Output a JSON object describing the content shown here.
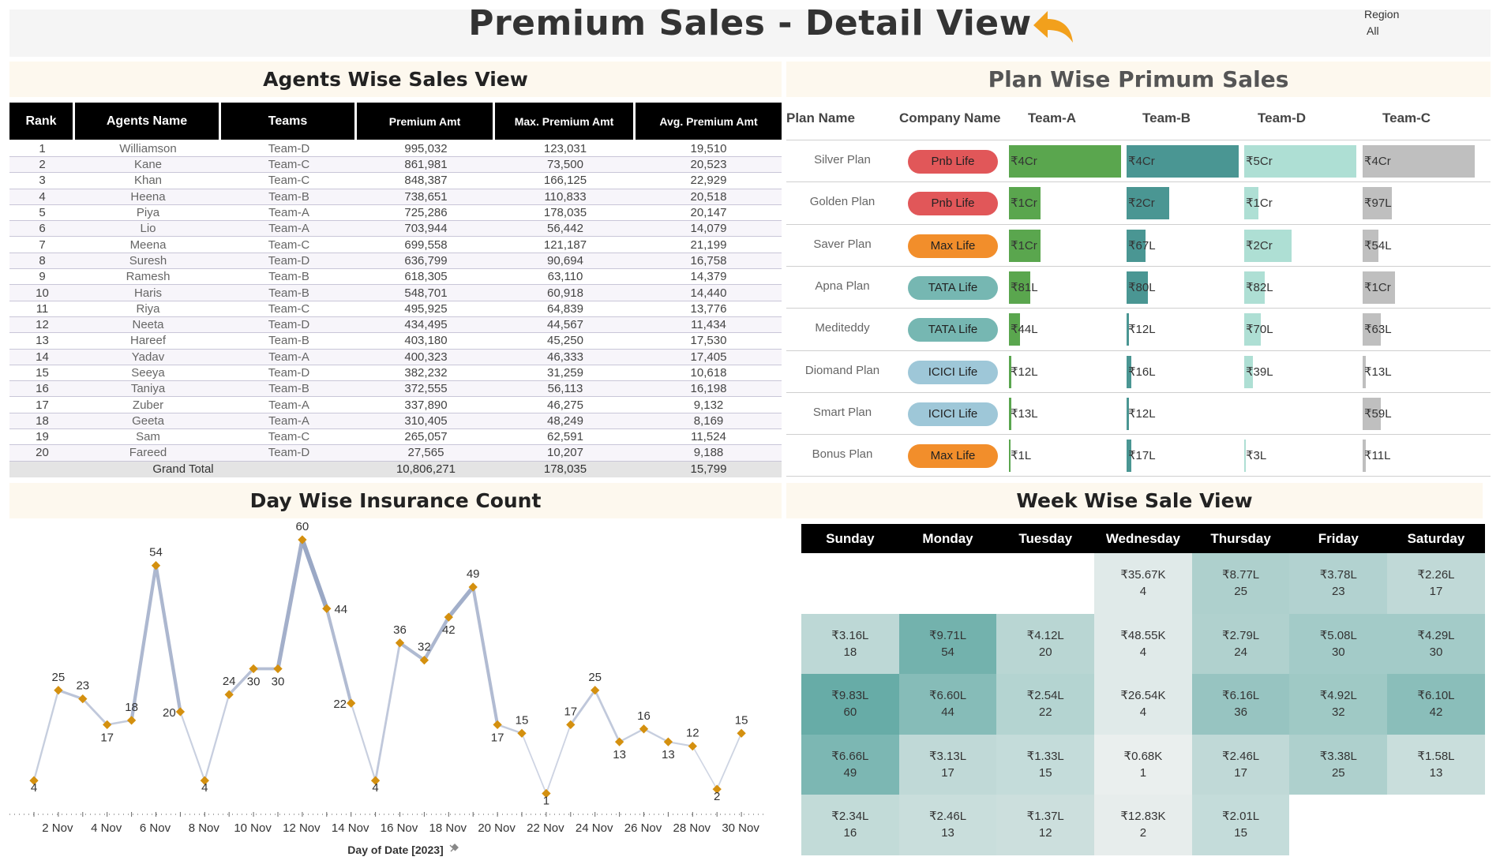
{
  "header": {
    "title": "Premium Sales - Detail View",
    "filter_label": "Region",
    "filter_value": "All",
    "back_icon": "back-arrow-icon"
  },
  "agents": {
    "title": "Agents Wise Sales View",
    "columns": [
      "Rank",
      "Agents Name",
      "Teams",
      "Premium Amt",
      "Max. Premium Amt",
      "Avg. Premium Amt"
    ],
    "rows": [
      [
        "1",
        "Williamson",
        "Team-D",
        "995,032",
        "123,031",
        "19,510"
      ],
      [
        "2",
        "Kane",
        "Team-C",
        "861,981",
        "73,500",
        "20,523"
      ],
      [
        "3",
        "Khan",
        "Team-C",
        "848,387",
        "166,125",
        "22,929"
      ],
      [
        "4",
        "Heena",
        "Team-B",
        "738,651",
        "110,833",
        "20,518"
      ],
      [
        "5",
        "Piya",
        "Team-A",
        "725,286",
        "178,035",
        "20,147"
      ],
      [
        "6",
        "Lio",
        "Team-A",
        "703,944",
        "56,442",
        "14,079"
      ],
      [
        "7",
        "Meena",
        "Team-C",
        "699,558",
        "121,187",
        "21,199"
      ],
      [
        "8",
        "Suresh",
        "Team-D",
        "636,799",
        "90,694",
        "16,758"
      ],
      [
        "9",
        "Ramesh",
        "Team-B",
        "618,305",
        "63,110",
        "14,379"
      ],
      [
        "10",
        "Haris",
        "Team-B",
        "548,701",
        "60,918",
        "14,440"
      ],
      [
        "11",
        "Riya",
        "Team-C",
        "495,925",
        "64,839",
        "13,776"
      ],
      [
        "12",
        "Neeta",
        "Team-D",
        "434,495",
        "44,567",
        "11,434"
      ],
      [
        "13",
        "Hareef",
        "Team-B",
        "403,180",
        "45,250",
        "17,530"
      ],
      [
        "14",
        "Yadav",
        "Team-A",
        "400,323",
        "46,333",
        "17,405"
      ],
      [
        "15",
        "Seeya",
        "Team-D",
        "382,232",
        "31,259",
        "10,618"
      ],
      [
        "16",
        "Taniya",
        "Team-B",
        "372,555",
        "56,113",
        "16,198"
      ],
      [
        "17",
        "Zuber",
        "Team-A",
        "337,890",
        "46,275",
        "9,132"
      ],
      [
        "18",
        "Geeta",
        "Team-A",
        "310,405",
        "48,249",
        "8,169"
      ],
      [
        "19",
        "Sam",
        "Team-C",
        "265,057",
        "62,591",
        "11,524"
      ],
      [
        "20",
        "Fareed",
        "Team-D",
        "27,565",
        "10,207",
        "9,188"
      ]
    ],
    "grand_total": {
      "label": "Grand Total",
      "premium": "10,806,271",
      "max": "178,035",
      "avg": "15,799"
    }
  },
  "plans": {
    "title": "Plan Wise Primum Sales",
    "columns": [
      "Plan Name",
      "Company Name",
      "Team-A",
      "Team-B",
      "Team-D",
      "Team-C"
    ],
    "team_colors": [
      "#5aa64e",
      "#4a9693",
      "#aedfd4",
      "#bfbfbf"
    ],
    "rows": [
      {
        "plan": "Silver Plan",
        "company": "Pnb Life",
        "company_color": "#e15759",
        "values": [
          {
            "label": "₹4Cr",
            "frac": 1.0
          },
          {
            "label": "₹4Cr",
            "frac": 1.0
          },
          {
            "label": "₹5Cr",
            "frac": 1.0
          },
          {
            "label": "₹4Cr",
            "frac": 1.0
          }
        ]
      },
      {
        "plan": "Golden Plan",
        "company": "Pnb Life",
        "company_color": "#e15759",
        "values": [
          {
            "label": "₹1Cr",
            "frac": 0.28
          },
          {
            "label": "₹2Cr",
            "frac": 0.38
          },
          {
            "label": "₹1Cr",
            "frac": 0.13
          },
          {
            "label": "₹97L",
            "frac": 0.26
          }
        ]
      },
      {
        "plan": "Saver Plan",
        "company": "Max Life",
        "company_color": "#f28e2b",
        "values": [
          {
            "label": "₹1Cr",
            "frac": 0.28
          },
          {
            "label": "₹67L",
            "frac": 0.17
          },
          {
            "label": "₹2Cr",
            "frac": 0.42
          },
          {
            "label": "₹54L",
            "frac": 0.14
          }
        ]
      },
      {
        "plan": "Apna Plan",
        "company": "TATA Life",
        "company_color": "#76b7b2",
        "values": [
          {
            "label": "₹81L",
            "frac": 0.19
          },
          {
            "label": "₹80L",
            "frac": 0.19
          },
          {
            "label": "₹82L",
            "frac": 0.18
          },
          {
            "label": "₹1Cr",
            "frac": 0.29
          }
        ]
      },
      {
        "plan": "Mediteddy",
        "company": "TATA Life",
        "company_color": "#76b7b2",
        "values": [
          {
            "label": "₹44L",
            "frac": 0.1
          },
          {
            "label": "₹12L",
            "frac": 0.02
          },
          {
            "label": "₹70L",
            "frac": 0.15
          },
          {
            "label": "₹63L",
            "frac": 0.16
          }
        ]
      },
      {
        "plan": "Diomand Plan",
        "company": "ICICI Life",
        "company_color": "#9ec7d8",
        "values": [
          {
            "label": "₹12L",
            "frac": 0.02
          },
          {
            "label": "₹16L",
            "frac": 0.04
          },
          {
            "label": "₹39L",
            "frac": 0.08
          },
          {
            "label": "₹13L",
            "frac": 0.03
          }
        ]
      },
      {
        "plan": "Smart Plan",
        "company": "ICICI Life",
        "company_color": "#9ec7d8",
        "values": [
          {
            "label": "₹13L",
            "frac": 0.02
          },
          {
            "label": "₹12L",
            "frac": 0.02
          },
          null,
          {
            "label": "₹59L",
            "frac": 0.16
          }
        ]
      },
      {
        "plan": "Bonus Plan",
        "company": "Max Life",
        "company_color": "#f28e2b",
        "values": [
          {
            "label": "₹1L",
            "frac": 0.01
          },
          {
            "label": "₹17L",
            "frac": 0.04
          },
          {
            "label": "₹3L",
            "frac": 0.01
          },
          {
            "label": "₹11L",
            "frac": 0.03
          }
        ]
      }
    ]
  },
  "day_chart": {
    "title": "Day Wise Insurance Count",
    "xlabel": "Day of Date [2023]",
    "x_ticks": [
      "2 Nov",
      "4 Nov",
      "6 Nov",
      "8 Nov",
      "10 Nov",
      "12 Nov",
      "14 Nov",
      "16 Nov",
      "18 Nov",
      "20 Nov",
      "22 Nov",
      "24 Nov",
      "26 Nov",
      "28 Nov",
      "30 Nov"
    ]
  },
  "chart_data": {
    "type": "line",
    "title": "Day Wise Insurance Count",
    "xlabel": "Day of Date [2023]",
    "ylabel": "",
    "x": [
      "1 Nov",
      "2 Nov",
      "3 Nov",
      "4 Nov",
      "5 Nov",
      "6 Nov",
      "7 Nov",
      "8 Nov",
      "9 Nov",
      "10 Nov",
      "11 Nov",
      "12 Nov",
      "13 Nov",
      "14 Nov",
      "15 Nov",
      "16 Nov",
      "17 Nov",
      "18 Nov",
      "19 Nov",
      "20 Nov",
      "21 Nov",
      "22 Nov",
      "23 Nov",
      "24 Nov",
      "25 Nov",
      "26 Nov",
      "27 Nov",
      "28 Nov",
      "29 Nov",
      "30 Nov"
    ],
    "values": [
      4,
      25,
      23,
      17,
      18,
      54,
      20,
      4,
      24,
      30,
      30,
      60,
      44,
      22,
      4,
      36,
      32,
      42,
      49,
      17,
      15,
      1,
      17,
      25,
      13,
      16,
      13,
      12,
      2,
      15
    ],
    "ylim": [
      0,
      65
    ],
    "grid": false
  },
  "week": {
    "title": "Week Wise Sale View",
    "days": [
      "Sunday",
      "Monday",
      "Tuesday",
      "Wednesday",
      "Thursday",
      "Friday",
      "Saturday"
    ],
    "rows": [
      [
        null,
        null,
        null,
        {
          "amount": "₹35.67K",
          "count": "4"
        },
        {
          "amount": "₹8.77L",
          "count": "25"
        },
        {
          "amount": "₹3.78L",
          "count": "23"
        },
        {
          "amount": "₹2.26L",
          "count": "17"
        }
      ],
      [
        {
          "amount": "₹3.16L",
          "count": "18"
        },
        {
          "amount": "₹9.71L",
          "count": "54"
        },
        {
          "amount": "₹4.12L",
          "count": "20"
        },
        {
          "amount": "₹48.55K",
          "count": "4"
        },
        {
          "amount": "₹2.79L",
          "count": "24"
        },
        {
          "amount": "₹5.08L",
          "count": "30"
        },
        {
          "amount": "₹4.29L",
          "count": "30"
        }
      ],
      [
        {
          "amount": "₹9.83L",
          "count": "60"
        },
        {
          "amount": "₹6.60L",
          "count": "44"
        },
        {
          "amount": "₹2.54L",
          "count": "22"
        },
        {
          "amount": "₹26.54K",
          "count": "4"
        },
        {
          "amount": "₹6.16L",
          "count": "36"
        },
        {
          "amount": "₹4.92L",
          "count": "32"
        },
        {
          "amount": "₹6.10L",
          "count": "42"
        }
      ],
      [
        {
          "amount": "₹6.66L",
          "count": "49"
        },
        {
          "amount": "₹3.13L",
          "count": "17"
        },
        {
          "amount": "₹1.33L",
          "count": "15"
        },
        {
          "amount": "₹0.68K",
          "count": "1"
        },
        {
          "amount": "₹2.46L",
          "count": "17"
        },
        {
          "amount": "₹3.38L",
          "count": "25"
        },
        {
          "amount": "₹1.58L",
          "count": "13"
        }
      ],
      [
        {
          "amount": "₹2.34L",
          "count": "16"
        },
        {
          "amount": "₹2.46L",
          "count": "13"
        },
        {
          "amount": "₹1.37L",
          "count": "12"
        },
        {
          "amount": "₹12.83K",
          "count": "2"
        },
        {
          "amount": "₹2.01L",
          "count": "15"
        },
        null,
        null
      ]
    ]
  }
}
